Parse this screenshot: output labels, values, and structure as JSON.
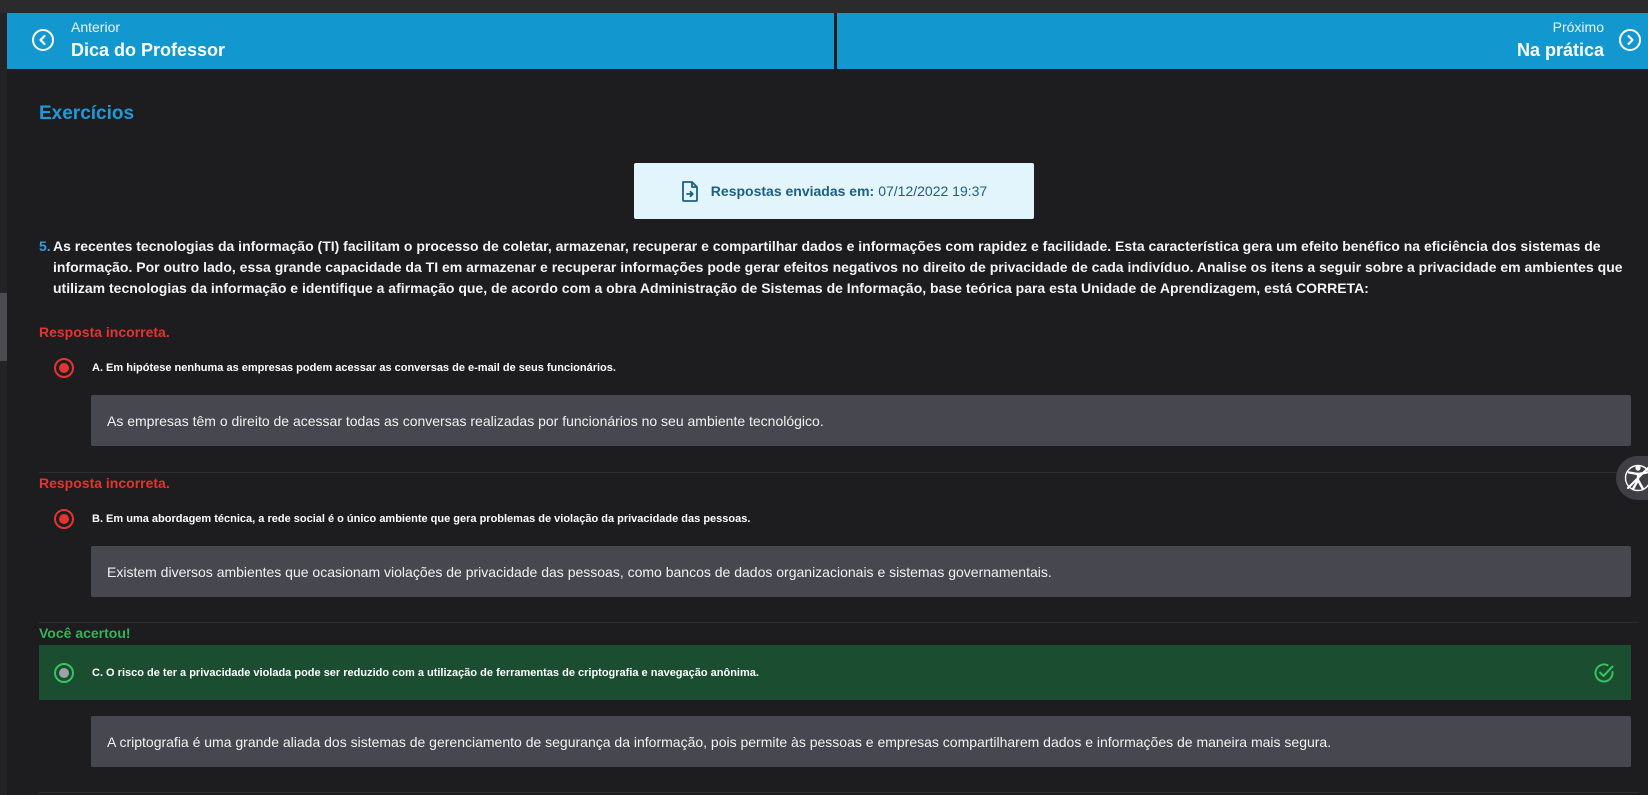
{
  "nav": {
    "previous": {
      "small_label": "Anterior",
      "title": "Dica do Professor",
      "icon": "chevron-left-circle-icon"
    },
    "next": {
      "small_label": "Próximo",
      "title": "Na prática",
      "icon": "chevron-right-circle-icon"
    }
  },
  "section_title": "Exercícios",
  "submission": {
    "icon": "document-arrow-icon",
    "label": "Respostas enviadas em:",
    "value": "07/12/2022 19:37"
  },
  "question": {
    "number": "5.",
    "text": "As recentes tecnologias da informação (TI) facilitam o processo de coletar, armazenar, recuperar e compartilhar dados e informações com rapidez e facilidade. Esta característica gera um efeito benéfico na eficiência dos sistemas de informação. Por outro lado, essa grande capacidade da TI em armazenar e recuperar informações pode gerar efeitos negativos no direito de privacidade de cada indivíduo. Analise os itens a seguir sobre a privacidade em ambientes que utilizam tecnologias da informação e identifique a afirmação que, de acordo com a obra Administração de Sistemas de Informação, base teórica para esta Unidade de Aprendizagem, está CORRETA:"
  },
  "options": [
    {
      "status": "Resposta incorreta.",
      "text": "A. Em hipótese nenhuma as empresas podem acessar as conversas de e-mail de seus funcionários.",
      "feedback": "As empresas têm o direito de acessar todas as conversas realizadas por funcionários no seu ambiente tecnológico."
    },
    {
      "status": "Resposta incorreta.",
      "text": "B. Em uma abordagem técnica, a rede social é o único ambiente que gera problemas de violação da privacidade das pessoas.",
      "feedback": "Existem diversos ambientes que ocasionam violações de privacidade das pessoas, como bancos de dados organizacionais e sistemas governamentais."
    },
    {
      "status": "Você acertou!",
      "text": "C. O risco de ter a privacidade violada pode ser reduzido com a utilização de ferramentas de criptografia e navegação anônima.",
      "feedback": "A criptografia é uma grande aliada dos sistemas de gerenciamento de segurança da informação, pois permite às pessoas e empresas compartilharem dados e informações de maneira mais segura."
    }
  ],
  "colors": {
    "nav_blue": "#1297cf",
    "incorrect_red": "#e3342f",
    "correct_green": "#2fb755",
    "correct_row_bg": "#1b4d31",
    "feedback_bg": "#47474f"
  },
  "accessibility_button": {
    "icon": "accessibility-icon"
  }
}
